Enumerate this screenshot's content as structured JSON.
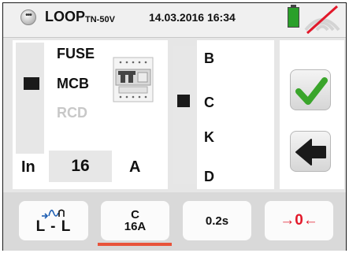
{
  "header": {
    "menu_icon": "menu-dots-icon",
    "title_main": "LOOP",
    "title_sub": "TN-50V",
    "datetime": "14.03.2016  16:34",
    "battery_icon": "battery-full-icon",
    "signal_icon": "no-signal-icon",
    "battery_color": "#2aa02a",
    "nosignal_color": "#e2182a"
  },
  "protection": {
    "options": [
      "FUSE",
      "MCB",
      "RCD"
    ],
    "selected": "MCB",
    "disabled": "RCD"
  },
  "nominal_current": {
    "label": "In",
    "value": "16",
    "unit": "A"
  },
  "curve": {
    "options": [
      "B",
      "C",
      "K",
      "D"
    ],
    "selected": "C"
  },
  "actions": {
    "confirm_icon": "checkmark-icon",
    "back_icon": "arrow-left-icon",
    "confirm_color": "#3aa52b"
  },
  "bottom_bar": {
    "mode_icon": "loop-waveform-icon",
    "mode_label": "L - L",
    "protection_line1": "C",
    "protection_line2": "16A",
    "time_label": "0.2s",
    "zero_label": "→0←",
    "accent_color": "#e8533a"
  }
}
